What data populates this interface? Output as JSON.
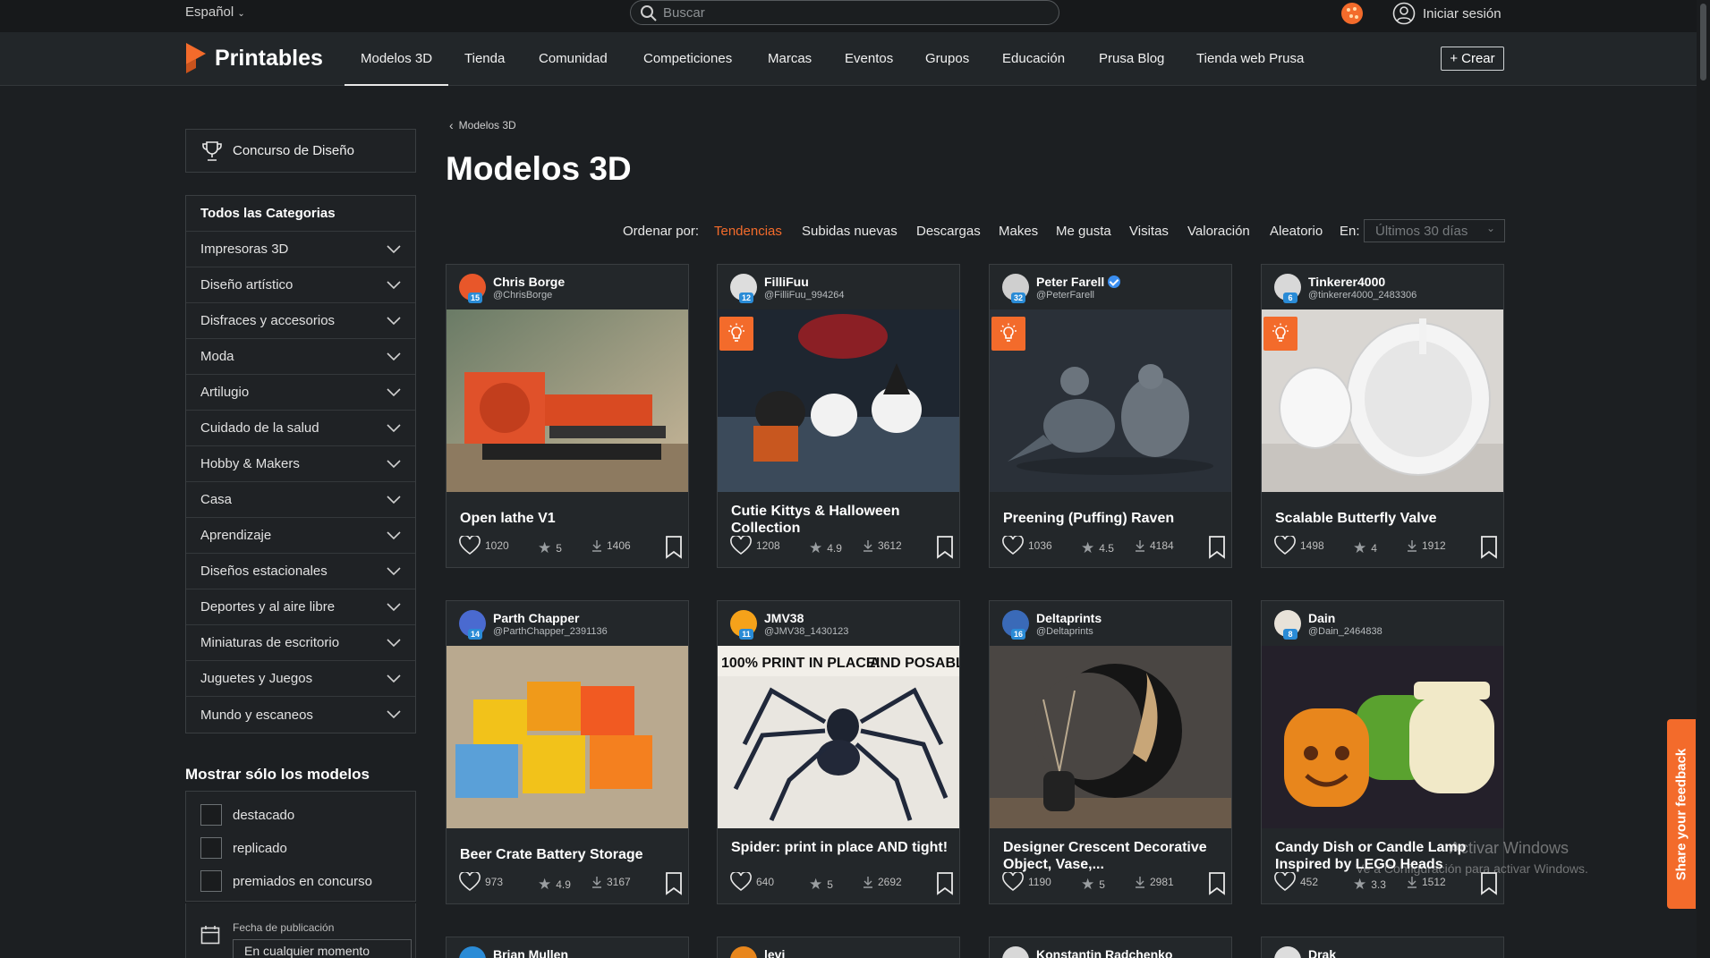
{
  "top": {
    "language": "Español",
    "search_placeholder": "Buscar",
    "login": "Iniciar sesión"
  },
  "nav": {
    "brand": "Printables",
    "items": [
      "Modelos 3D",
      "Tienda",
      "Comunidad",
      "Competiciones",
      "Marcas",
      "Eventos",
      "Grupos",
      "Educación",
      "Prusa Blog",
      "Tienda web Prusa"
    ],
    "active": "Modelos 3D",
    "create": "Crear"
  },
  "sidebar": {
    "contest": "Concurso de Diseño",
    "all_categories": "Todos las Categorias",
    "categories": [
      "Impresoras 3D",
      "Diseño artístico",
      "Disfraces y accesorios",
      "Moda",
      "Artilugio",
      "Cuidado de la salud",
      "Hobby & Makers",
      "Casa",
      "Aprendizaje",
      "Diseños estacionales",
      "Deportes y al aire libre",
      "Miniaturas de escritorio",
      "Juguetes y Juegos",
      "Mundo y escaneos"
    ],
    "show_only_title": "Mostrar sólo los modelos",
    "filters": [
      "destacado",
      "replicado",
      "premiados en concurso"
    ],
    "date_label": "Fecha de publicación",
    "date_value": "En cualquier momento"
  },
  "main": {
    "breadcrumb": "Modelos 3D",
    "title": "Modelos 3D",
    "sort_label": "Ordenar por:",
    "sort_options": [
      "Tendencias",
      "Subidas nuevas",
      "Descargas",
      "Makes",
      "Me gusta",
      "Visitas",
      "Valoración",
      "Aleatorio"
    ],
    "sort_active": "Tendencias",
    "period_label": "En:",
    "period_value": "Últimos 30 días"
  },
  "cards": [
    {
      "user": "Chris Borge",
      "handle": "@ChrisBorge",
      "level": "15",
      "title": "Open lathe V1",
      "likes": "1020",
      "rating": "5",
      "downloads": "1406",
      "featured": false,
      "verified": false
    },
    {
      "user": "FilliFuu",
      "handle": "@FilliFuu_994264",
      "level": "12",
      "title": "Cutie Kittys & Halloween Collection",
      "likes": "1208",
      "rating": "4.9",
      "downloads": "3612",
      "featured": true,
      "verified": false
    },
    {
      "user": "Peter Farell",
      "handle": "@PeterFarell",
      "level": "32",
      "title": "Preening (Puffing) Raven",
      "likes": "1036",
      "rating": "4.5",
      "downloads": "4184",
      "featured": true,
      "verified": true
    },
    {
      "user": "Tinkerer4000",
      "handle": "@tinkerer4000_2483306",
      "level": "6",
      "title": "Scalable Butterfly Valve",
      "likes": "1498",
      "rating": "4",
      "downloads": "1912",
      "featured": true,
      "verified": false
    },
    {
      "user": "Parth Chapper",
      "handle": "@ParthChapper_2391136",
      "level": "14",
      "title": "Beer Crate Battery Storage",
      "likes": "973",
      "rating": "4.9",
      "downloads": "3167",
      "featured": false,
      "verified": false
    },
    {
      "user": "JMV38",
      "handle": "@JMV38_1430123",
      "level": "11",
      "title": "Spider: print in place AND tight!",
      "likes": "640",
      "rating": "5",
      "downloads": "2692",
      "featured": false,
      "verified": false,
      "image_text_left": "100% PRINT IN PLACE!",
      "image_text_right": "AND POSABLE!"
    },
    {
      "user": "Deltaprints",
      "handle": "@Deltaprints",
      "level": "16",
      "title": "Designer Crescent Decorative Object, Vase,...",
      "likes": "1190",
      "rating": "5",
      "downloads": "2981",
      "featured": false,
      "verified": false
    },
    {
      "user": "Dain",
      "handle": "@Dain_2464838",
      "level": "8",
      "title": "Candy Dish or Candle Lamp Inspired by LEGO Heads",
      "likes": "452",
      "rating": "3.3",
      "downloads": "1512",
      "featured": false,
      "verified": false
    }
  ],
  "next_row_users": [
    "Brian Mullen",
    "levi",
    "Konstantin Radchenko",
    "Drak"
  ],
  "feedback": "Share your feedback",
  "watermark": {
    "line1": "Activar Windows",
    "line2": "Ve a Configuración para activar Windows."
  },
  "colors": {
    "accent": "#f36b2b",
    "background": "#1c1f22",
    "card": "#23272a"
  }
}
